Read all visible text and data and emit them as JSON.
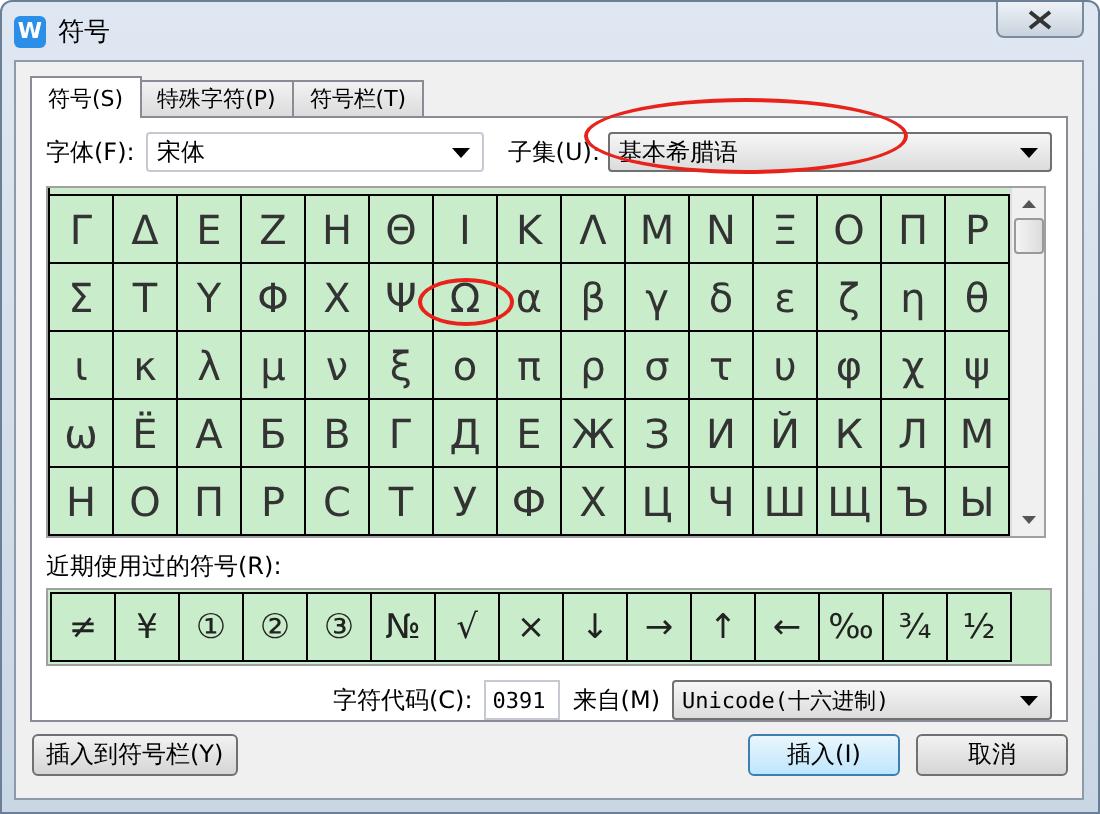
{
  "window": {
    "logo": "W",
    "title": "符号"
  },
  "tabs": [
    {
      "label": "符号(S)",
      "selected": true
    },
    {
      "label": "特殊字符(P)",
      "selected": false
    },
    {
      "label": "符号栏(T)",
      "selected": false
    }
  ],
  "font": {
    "label": "字体(F):",
    "value": "宋体"
  },
  "subset": {
    "label": "子集(U):",
    "value": "基本希腊语",
    "circled": true
  },
  "symbol_grid": {
    "rows": [
      [
        {
          "char": "Γ",
          "circled": false
        },
        {
          "char": "Δ",
          "circled": false
        },
        {
          "char": "Ε",
          "circled": false
        },
        {
          "char": "Ζ",
          "circled": false
        },
        {
          "char": "Η",
          "circled": false
        },
        {
          "char": "Θ",
          "circled": false
        },
        {
          "char": "Ι",
          "circled": false
        },
        {
          "char": "Κ",
          "circled": false
        },
        {
          "char": "Λ",
          "circled": false
        },
        {
          "char": "Μ",
          "circled": false
        },
        {
          "char": "Ν",
          "circled": false
        },
        {
          "char": "Ξ",
          "circled": false
        },
        {
          "char": "Ο",
          "circled": false
        },
        {
          "char": "Π",
          "circled": false
        },
        {
          "char": "Ρ",
          "circled": false
        }
      ],
      [
        {
          "char": "Σ",
          "circled": false
        },
        {
          "char": "Τ",
          "circled": false
        },
        {
          "char": "Υ",
          "circled": false
        },
        {
          "char": "Φ",
          "circled": false
        },
        {
          "char": "Χ",
          "circled": false
        },
        {
          "char": "Ψ",
          "circled": false
        },
        {
          "char": "Ω",
          "circled": true
        },
        {
          "char": "α",
          "circled": false
        },
        {
          "char": "β",
          "circled": false
        },
        {
          "char": "γ",
          "circled": false
        },
        {
          "char": "δ",
          "circled": false
        },
        {
          "char": "ε",
          "circled": false
        },
        {
          "char": "ζ",
          "circled": false
        },
        {
          "char": "η",
          "circled": false
        },
        {
          "char": "θ",
          "circled": false
        }
      ],
      [
        {
          "char": "ι",
          "circled": false
        },
        {
          "char": "κ",
          "circled": false
        },
        {
          "char": "λ",
          "circled": false
        },
        {
          "char": "μ",
          "circled": false
        },
        {
          "char": "ν",
          "circled": false
        },
        {
          "char": "ξ",
          "circled": false
        },
        {
          "char": "ο",
          "circled": false
        },
        {
          "char": "π",
          "circled": false
        },
        {
          "char": "ρ",
          "circled": false
        },
        {
          "char": "σ",
          "circled": false
        },
        {
          "char": "τ",
          "circled": false
        },
        {
          "char": "υ",
          "circled": false
        },
        {
          "char": "φ",
          "circled": false
        },
        {
          "char": "χ",
          "circled": false
        },
        {
          "char": "ψ",
          "circled": false
        }
      ],
      [
        {
          "char": "ω",
          "circled": false
        },
        {
          "char": "Ё",
          "circled": false
        },
        {
          "char": "А",
          "circled": false
        },
        {
          "char": "Б",
          "circled": false
        },
        {
          "char": "В",
          "circled": false
        },
        {
          "char": "Г",
          "circled": false
        },
        {
          "char": "Д",
          "circled": false
        },
        {
          "char": "Е",
          "circled": false
        },
        {
          "char": "Ж",
          "circled": false
        },
        {
          "char": "З",
          "circled": false
        },
        {
          "char": "И",
          "circled": false
        },
        {
          "char": "Й",
          "circled": false
        },
        {
          "char": "К",
          "circled": false
        },
        {
          "char": "Л",
          "circled": false
        },
        {
          "char": "М",
          "circled": false
        }
      ],
      [
        {
          "char": "Н",
          "circled": false
        },
        {
          "char": "О",
          "circled": false
        },
        {
          "char": "П",
          "circled": false
        },
        {
          "char": "Р",
          "circled": false
        },
        {
          "char": "С",
          "circled": false
        },
        {
          "char": "Т",
          "circled": false
        },
        {
          "char": "У",
          "circled": false
        },
        {
          "char": "Ф",
          "circled": false
        },
        {
          "char": "Х",
          "circled": false
        },
        {
          "char": "Ц",
          "circled": false
        },
        {
          "char": "Ч",
          "circled": false
        },
        {
          "char": "Ш",
          "circled": false
        },
        {
          "char": "Щ",
          "circled": false
        },
        {
          "char": "Ъ",
          "circled": false
        },
        {
          "char": "Ы",
          "circled": false
        }
      ]
    ]
  },
  "recent": {
    "label": "近期使用过的符号(R):",
    "symbols": [
      "≠",
      "¥",
      "①",
      "②",
      "③",
      "№",
      "√",
      "×",
      "↓",
      "→",
      "↑",
      "←",
      "‰",
      "¾",
      "½"
    ]
  },
  "char_code": {
    "label": "字符代码(C):",
    "value": "0391"
  },
  "from": {
    "label": "来自(M)",
    "value": "Unicode(十六进制)"
  },
  "buttons": {
    "insert_to_bar": "插入到符号栏(Y)",
    "insert": "插入(I)",
    "cancel": "取消"
  }
}
